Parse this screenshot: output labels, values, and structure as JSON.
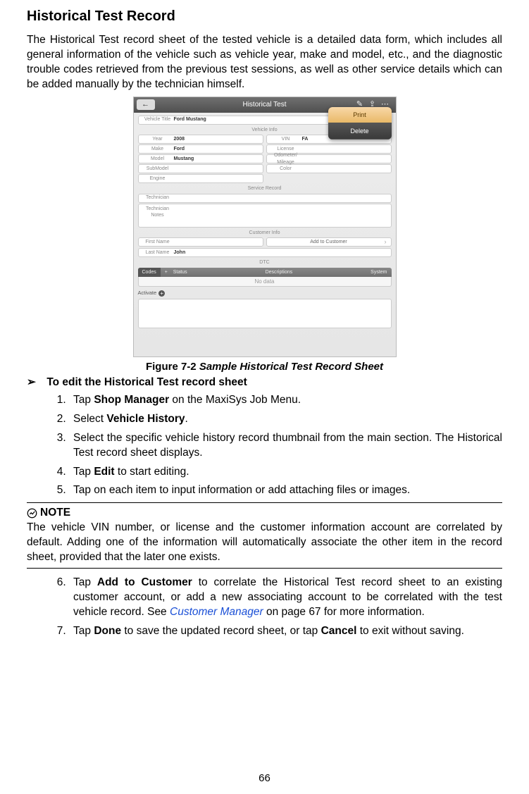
{
  "title": "Historical Test Record",
  "intro": "The Historical Test record sheet of the tested vehicle is a detailed data form, which includes all general information of the vehicle such as vehicle year, make and model, etc., and the diagnostic trouble codes retrieved from the previous test sessions, as well as other service details which can be added manually by the technician himself.",
  "figure": {
    "label_prefix": "Figure 7-2",
    "label_title": "Sample Historical Test Record Sheet"
  },
  "screenshot": {
    "topbar_title": "Historical Test",
    "menu_print": "Print",
    "menu_delete": "Delete",
    "vehicle_title_label": "Vehicle Title",
    "vehicle_title_value": "Ford Mustang",
    "vehicle_info_label": "Vehicle Info",
    "year_label": "Year",
    "year_value": "2008",
    "make_label": "Make",
    "make_value": "Ford",
    "model_label": "Model",
    "model_value": "Mustang",
    "submodel_label": "SubModel",
    "engine_label": "Engine",
    "vin_label": "VIN",
    "vin_value": "FA",
    "license_label": "License",
    "odo_label": "Odometer/\nMileage",
    "color_label": "Color",
    "service_record_label": "Service Record",
    "technician_label": "Technician",
    "tech_notes_label": "Technician\nNotes",
    "customer_info_label": "Customer Info",
    "first_name_label": "First Name",
    "add_customer_label": "Add to  Customer",
    "last_name_label": "Last Name",
    "last_name_value": "John",
    "dtc_label": "DTC",
    "dtc_codes": "Codes",
    "dtc_status": "Status",
    "dtc_desc": "Descriptions",
    "dtc_system": "System",
    "no_data": "No data",
    "activate_label": "Activate"
  },
  "subhead_arrow": "➢",
  "subhead": "To edit the Historical Test record sheet",
  "steps_a": [
    {
      "pre": "Tap ",
      "bold": "Shop Manager",
      "post": " on the MaxiSys Job Menu."
    },
    {
      "pre": "Select ",
      "bold": "Vehicle History",
      "post": "."
    },
    {
      "plain": "Select the specific vehicle history record thumbnail from the main section. The Historical Test record sheet displays."
    },
    {
      "pre": "Tap ",
      "bold": "Edit",
      "post": " to start editing."
    },
    {
      "plain": "Tap on each item to input information or add attaching files or images."
    }
  ],
  "note": {
    "label": "NOTE",
    "body": "The vehicle VIN number, or license and the customer information account are correlated by default. Adding one of the information will automatically associate the other item in the record sheet, provided that the later one exists."
  },
  "steps_b": {
    "s6_pre": "Tap ",
    "s6_b1": "Add to Customer",
    "s6_mid": " to correlate the Historical Test record sheet to an existing customer account, or add a new associating account to be correlated with the test vehicle record. See ",
    "s6_link": "Customer Manager",
    "s6_post": " on page 67 for more information.",
    "s7_pre": "Tap ",
    "s7_b1": "Done",
    "s7_mid": " to save the updated record sheet, or tap ",
    "s7_b2": "Cancel",
    "s7_post": " to exit without saving."
  },
  "page_number": "66"
}
